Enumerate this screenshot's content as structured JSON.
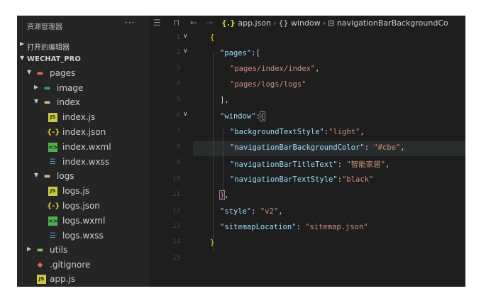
{
  "sidebar": {
    "title": "资源管理器",
    "more": "···",
    "open_editors": "打开的编辑器",
    "project": "WECHAT_PRO",
    "tree": [
      {
        "label": "pages",
        "kind": "folder-pages",
        "level": 1,
        "expanded": true
      },
      {
        "label": "image",
        "kind": "folder-image",
        "level": 2,
        "expanded": false
      },
      {
        "label": "index",
        "kind": "folder",
        "level": 2,
        "expanded": true
      },
      {
        "label": "index.js",
        "kind": "js",
        "level": 3
      },
      {
        "label": "index.json",
        "kind": "json",
        "level": 3
      },
      {
        "label": "index.wxml",
        "kind": "wxml",
        "level": 3
      },
      {
        "label": "index.wxss",
        "kind": "wxss",
        "level": 3
      },
      {
        "label": "logs",
        "kind": "folder-logs",
        "level": 2,
        "expanded": true
      },
      {
        "label": "logs.js",
        "kind": "js",
        "level": 3
      },
      {
        "label": "logs.json",
        "kind": "json",
        "level": 3
      },
      {
        "label": "logs.wxml",
        "kind": "wxml",
        "level": 3
      },
      {
        "label": "logs.wxss",
        "kind": "wxss",
        "level": 3
      },
      {
        "label": "utils",
        "kind": "folder-utils",
        "level": 1,
        "expanded": false
      },
      {
        "label": ".gitignore",
        "kind": "git",
        "level": 1
      },
      {
        "label": "app.js",
        "kind": "js",
        "level": 1
      }
    ]
  },
  "breadcrumb": {
    "file_icon": "{.}",
    "file": "app.json",
    "seg2_icon": "{}",
    "seg2": "window",
    "seg3": "navigationBarBackgroundCo"
  },
  "code": {
    "line_numbers": [
      "1",
      "2",
      "3",
      "4",
      "5",
      "6",
      "7",
      "8",
      "9",
      "10",
      "11",
      "12",
      "13",
      "14",
      "15"
    ],
    "l1": "{",
    "l2_key": "\"pages\"",
    "l2_rest": ":[",
    "l3": "\"pages/index/index\"",
    "l3_comma": ",",
    "l4": "\"pages/logs/logs\"",
    "l5": "],",
    "l6_key": "\"window\"",
    "l6_colon": ":",
    "l6_brace": "{",
    "l7_key": "\"backgroundTextStyle\"",
    "l7_colon": ":",
    "l7_val": "\"light\"",
    "l7_comma": ",",
    "l8_key": "\"navigationBarBackgroundColor\"",
    "l8_colon": ": ",
    "l8_val": "\"#cbe\"",
    "l8_comma": ",",
    "l9_key": "\"navigationBarTitleText\"",
    "l9_colon": ": ",
    "l9_val": "\"智能家居\"",
    "l9_comma": ",",
    "l10_key": "\"navigationBarTextStyle\"",
    "l10_colon": ":",
    "l10_val": "\"black\"",
    "l11_brace": "}",
    "l11_comma": ",",
    "l12_key": "\"style\"",
    "l12_colon": ": ",
    "l12_val": "\"v2\"",
    "l12_comma": ",",
    "l13_key": "\"sitemapLocation\"",
    "l13_colon": ": ",
    "l13_val": "\"sitemap.json\"",
    "l14": "}"
  },
  "colors": {
    "js": "#cbcb41",
    "json": "#cbcb41",
    "wxml": "#4caf50",
    "wxss": "#519aba",
    "folder": "#dcb67a",
    "pages_folder": "#e06c4b",
    "image_folder": "#2e9e8f",
    "git": "#e06c4b"
  }
}
